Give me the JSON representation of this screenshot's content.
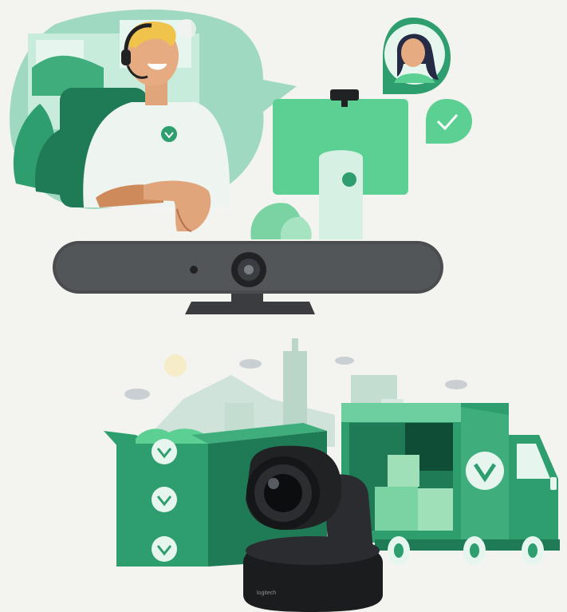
{
  "scene_top": {
    "name": "support-agent-video-call",
    "icons": [
      "headset-icon",
      "heart-badge-icon",
      "check-bubble-icon",
      "avatar-bubble-icon"
    ]
  },
  "scene_bottom": {
    "name": "delivery-truck-city",
    "icons": [
      "heart-badge-icon"
    ]
  },
  "products": {
    "video_bar": {
      "name": "video-bar-device"
    },
    "ptz_camera": {
      "name": "ptz-camera-device",
      "brand": "logitech"
    }
  },
  "colors": {
    "background": "#f3f3f0",
    "green_primary": "#2f9e6e",
    "green_dark": "#1f7a56",
    "mint": "#9fd9c2",
    "device_gray": "#4a4c4f",
    "device_black": "#202224"
  }
}
